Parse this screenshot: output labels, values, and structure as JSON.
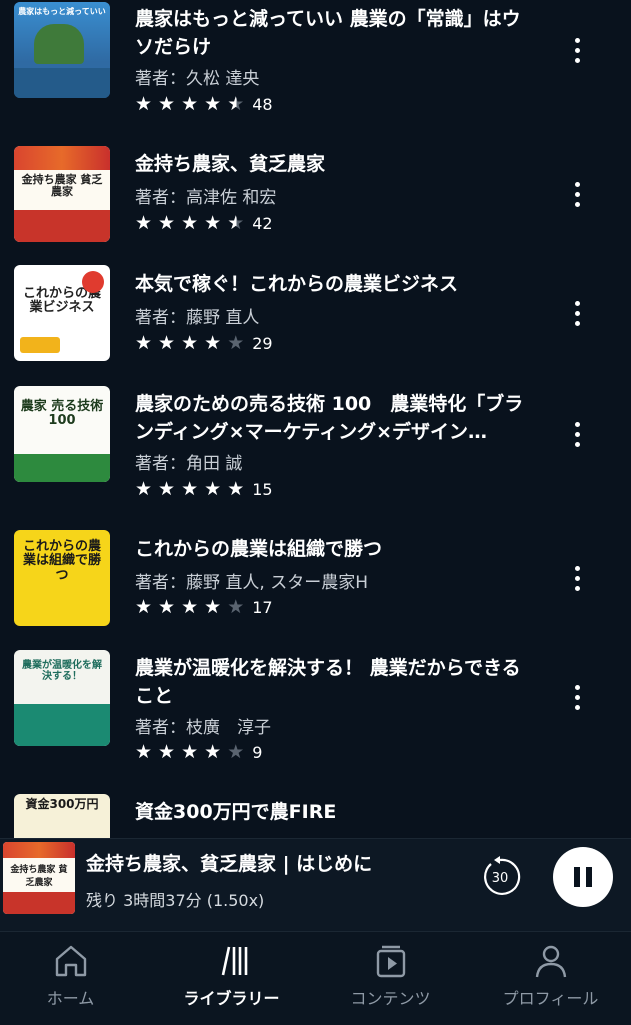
{
  "books": [
    {
      "title": "農家はもっと減っていい 農業の「常識」はウソだらけ",
      "author": "著者：久松 達央",
      "stars": [
        1,
        1,
        1,
        1,
        0.5
      ],
      "count": "48",
      "cover_text": "農家はもっと減っていい"
    },
    {
      "title": "金持ち農家、貧乏農家",
      "author": "著者：高津佐 和宏",
      "stars": [
        1,
        1,
        1,
        1,
        0.5
      ],
      "count": "42",
      "cover_text": "金持ち農家 貧乏農家"
    },
    {
      "title": "本気で稼ぐ！これからの農業ビジネス",
      "author": "著者：藤野 直人",
      "stars": [
        1,
        1,
        1,
        1,
        0
      ],
      "count": "29",
      "cover_text": "これからの農業ビジネス"
    },
    {
      "title": "農家のための売る技術 100　農業特化「ブランディング×マーケティング×デザイン…",
      "author": "著者：角田 誠",
      "stars": [
        1,
        1,
        1,
        1,
        1
      ],
      "count": "15",
      "cover_text": "農家 売る技術100"
    },
    {
      "title": "これからの農業は組織で勝つ",
      "author": "著者：藤野 直人, スター農家H",
      "stars": [
        1,
        1,
        1,
        1,
        0
      ],
      "count": "17",
      "cover_text": "これからの農業は組織で勝つ"
    },
    {
      "title": "農業が温暖化を解決する！ 農業だからできること",
      "author": "著者：枝廣　淳子",
      "stars": [
        1,
        1,
        1,
        1,
        0
      ],
      "count": "9",
      "cover_text": "農業が温暖化を解決する！"
    },
    {
      "title": "資金300万円で農FIRE",
      "author": "",
      "stars": [],
      "count": "",
      "cover_text": "資金300万円"
    }
  ],
  "player": {
    "title": "金持ち農家、貧乏農家 | はじめに",
    "subtitle": "残り 3時間37分 (1.50x)",
    "skip_seconds": "30",
    "cover_text": "金持ち農家 貧乏農家"
  },
  "nav": {
    "home": "ホーム",
    "library": "ライブラリー",
    "contents": "コンテンツ",
    "profile": "プロフィール"
  },
  "colors": {
    "background": "#09121d",
    "text": "#ffffff",
    "star_empty": "#5a6470",
    "nav_inactive": "#8f9aa6"
  }
}
